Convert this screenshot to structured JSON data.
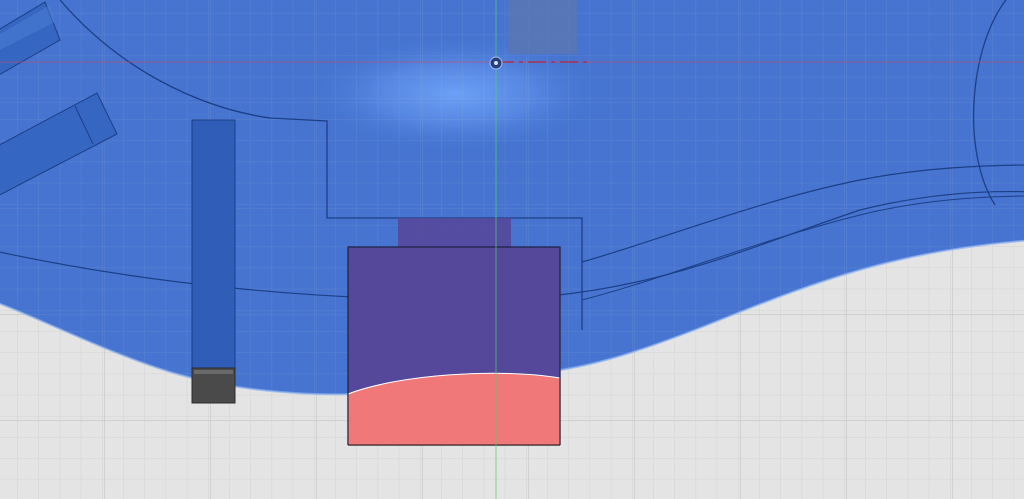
{
  "viewport": {
    "view": "top",
    "grid": true
  },
  "colors": {
    "background": "#e4e4e4",
    "grid_minor": "#d2d2d2",
    "grid_major": "#c2c2c2",
    "body_fill": "#3f6fcf",
    "body_highlight": "#6aa0f5",
    "body_edge": "#1d3f86",
    "selected_block": "#55489a",
    "intersect_region": "#f07878",
    "dark_tab": "#4a4a4a",
    "x_axis": "#c64a6a",
    "y_axis": "#4fcf6a",
    "origin": "#2a3f7a"
  },
  "icons": {
    "origin": "origin-point-icon"
  }
}
